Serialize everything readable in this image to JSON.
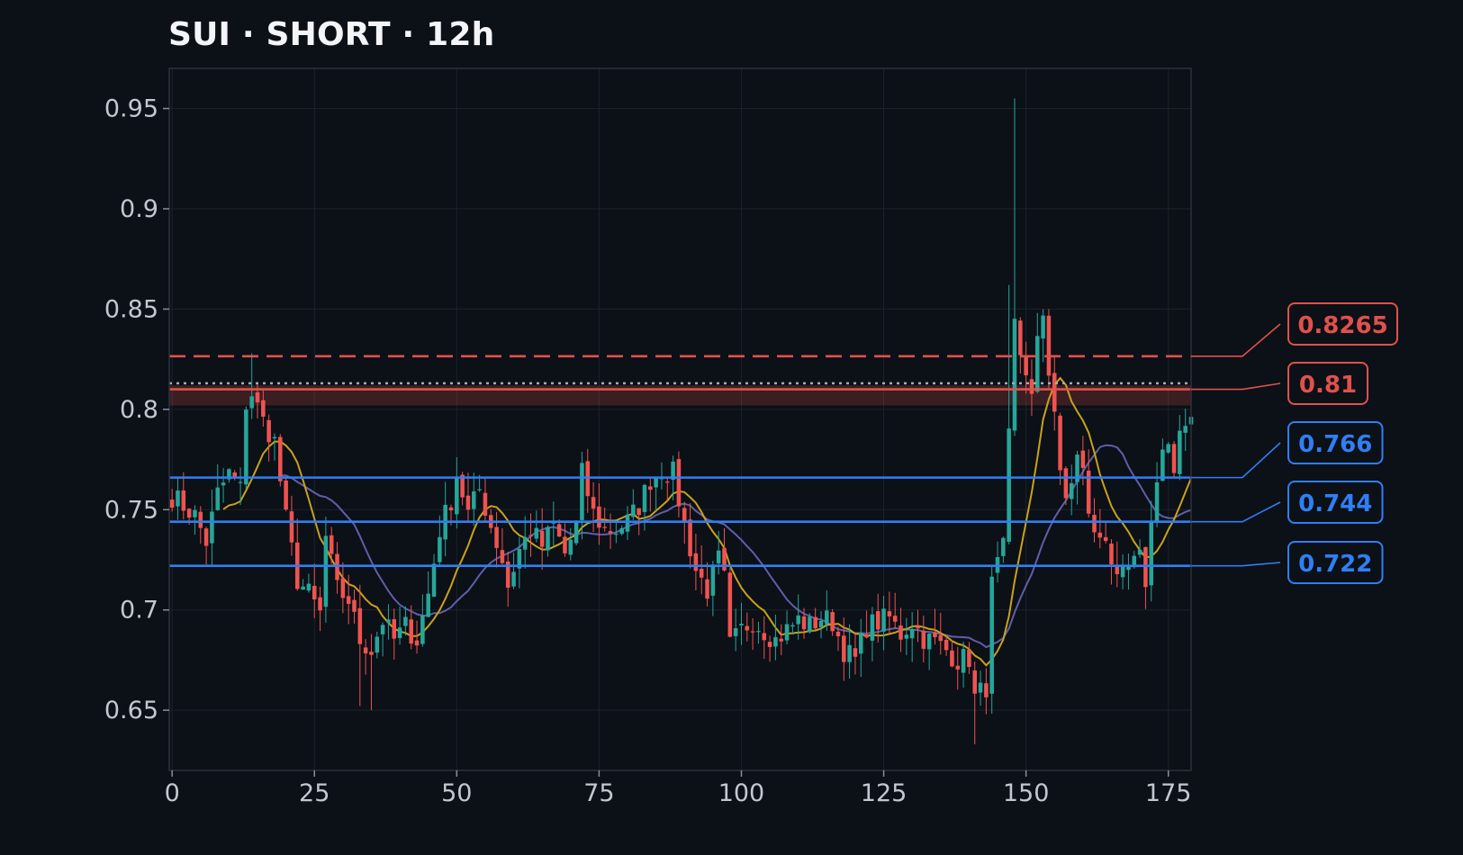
{
  "title": "SUI · SHORT · 12h",
  "colors": {
    "background": "#0c1017",
    "bullish": "#26a69a",
    "bearish": "#ef5350",
    "resistance": "#e0514c",
    "support": "#2f7ff5",
    "ma_fast": "#c9a21b",
    "ma_slow": "#5e5fa8",
    "entry": "#a8aab0",
    "grid": "#1c222b",
    "frame": "#2c323c"
  },
  "chart_data": {
    "type": "candlestick",
    "title": "SUI · SHORT · 12h",
    "xlim": [
      -0.5,
      179
    ],
    "ylim": [
      0.62,
      0.97
    ],
    "x_ticks": [
      0,
      25,
      50,
      75,
      100,
      125,
      150,
      175
    ],
    "x_tick_labels": [
      "0",
      "25",
      "50",
      "75",
      "100",
      "125",
      "150",
      "175"
    ],
    "y_ticks": [
      0.65,
      0.7,
      0.75,
      0.8,
      0.85,
      0.9,
      0.95
    ],
    "y_tick_labels": [
      "0.65",
      "0.7",
      "0.75",
      "0.8",
      "0.85",
      "0.9",
      "0.95"
    ],
    "grid": true,
    "levels": [
      {
        "value": 0.8265,
        "label": "0.8265",
        "style": "dashed",
        "kind": "resistance"
      },
      {
        "value": 0.81,
        "label": "0.81",
        "style": "solid",
        "kind": "resistance",
        "zone": [
          0.802,
          0.812
        ]
      },
      {
        "value": 0.766,
        "label": "0.766",
        "style": "solid",
        "kind": "support"
      },
      {
        "value": 0.744,
        "label": "0.744",
        "style": "solid",
        "kind": "support"
      },
      {
        "value": 0.722,
        "label": "0.722",
        "style": "solid",
        "kind": "support"
      }
    ],
    "entry_line": {
      "value": 0.813,
      "style": "dotted"
    },
    "close_anchors": [
      [
        0,
        0.757
      ],
      [
        4,
        0.747
      ],
      [
        6,
        0.734
      ],
      [
        8,
        0.758
      ],
      [
        10,
        0.768
      ],
      [
        12,
        0.76
      ],
      [
        13,
        0.803
      ],
      [
        14,
        0.808
      ],
      [
        16,
        0.794
      ],
      [
        18,
        0.784
      ],
      [
        20,
        0.745
      ],
      [
        22,
        0.715
      ],
      [
        24,
        0.708
      ],
      [
        26,
        0.698
      ],
      [
        27,
        0.736
      ],
      [
        29,
        0.71
      ],
      [
        31,
        0.705
      ],
      [
        33,
        0.685
      ],
      [
        35,
        0.68
      ],
      [
        37,
        0.695
      ],
      [
        39,
        0.685
      ],
      [
        41,
        0.692
      ],
      [
        43,
        0.685
      ],
      [
        45,
        0.708
      ],
      [
        47,
        0.74
      ],
      [
        49,
        0.755
      ],
      [
        50,
        0.768
      ],
      [
        52,
        0.748
      ],
      [
        54,
        0.76
      ],
      [
        56,
        0.742
      ],
      [
        58,
        0.725
      ],
      [
        59,
        0.712
      ],
      [
        61,
        0.73
      ],
      [
        63,
        0.74
      ],
      [
        65,
        0.732
      ],
      [
        67,
        0.742
      ],
      [
        69,
        0.728
      ],
      [
        71,
        0.742
      ],
      [
        72,
        0.768
      ],
      [
        74,
        0.748
      ],
      [
        76,
        0.74
      ],
      [
        78,
        0.74
      ],
      [
        80,
        0.744
      ],
      [
        82,
        0.752
      ],
      [
        84,
        0.765
      ],
      [
        86,
        0.77
      ],
      [
        88,
        0.768
      ],
      [
        90,
        0.742
      ],
      [
        92,
        0.72
      ],
      [
        94,
        0.71
      ],
      [
        96,
        0.725
      ],
      [
        97,
        0.715
      ],
      [
        98,
        0.682
      ],
      [
        100,
        0.69
      ],
      [
        102,
        0.695
      ],
      [
        104,
        0.69
      ],
      [
        106,
        0.685
      ],
      [
        108,
        0.69
      ],
      [
        110,
        0.695
      ],
      [
        112,
        0.692
      ],
      [
        114,
        0.696
      ],
      [
        116,
        0.694
      ],
      [
        118,
        0.68
      ],
      [
        120,
        0.675
      ],
      [
        122,
        0.692
      ],
      [
        124,
        0.694
      ],
      [
        126,
        0.696
      ],
      [
        128,
        0.688
      ],
      [
        130,
        0.694
      ],
      [
        132,
        0.686
      ],
      [
        134,
        0.684
      ],
      [
        136,
        0.68
      ],
      [
        138,
        0.675
      ],
      [
        140,
        0.676
      ],
      [
        141,
        0.656
      ],
      [
        143,
        0.662
      ],
      [
        144,
        0.712
      ],
      [
        145,
        0.722
      ],
      [
        146,
        0.73
      ],
      [
        147,
        0.785
      ],
      [
        148,
        0.842
      ],
      [
        149,
        0.828
      ],
      [
        150,
        0.82
      ],
      [
        151,
        0.805
      ],
      [
        152,
        0.832
      ],
      [
        153,
        0.848
      ],
      [
        154,
        0.82
      ],
      [
        155,
        0.8
      ],
      [
        156,
        0.765
      ],
      [
        157,
        0.755
      ],
      [
        158,
        0.765
      ],
      [
        159,
        0.776
      ],
      [
        160,
        0.768
      ],
      [
        161,
        0.75
      ],
      [
        162,
        0.736
      ],
      [
        164,
        0.738
      ],
      [
        166,
        0.712
      ],
      [
        168,
        0.72
      ],
      [
        170,
        0.725
      ],
      [
        171,
        0.715
      ],
      [
        172,
        0.742
      ],
      [
        173,
        0.768
      ],
      [
        174,
        0.78
      ],
      [
        175,
        0.782
      ],
      [
        176,
        0.765
      ],
      [
        177,
        0.784
      ],
      [
        178,
        0.792
      ],
      [
        179,
        0.8
      ]
    ],
    "candle_count": 180,
    "ma_fast_period": 10,
    "ma_slow_period": 20
  }
}
